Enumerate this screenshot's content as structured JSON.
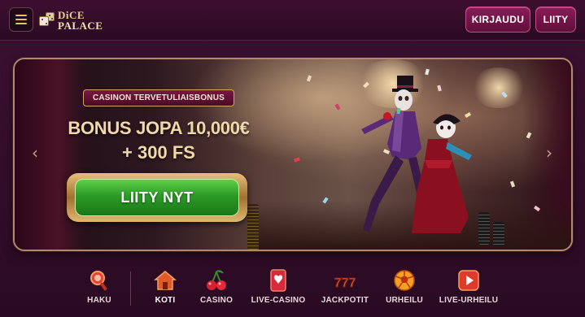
{
  "header": {
    "logo_line1": "DiCE",
    "logo_line2": "PALACE",
    "login_label": "KIRJAUDU",
    "join_label": "LIITY"
  },
  "banner": {
    "tag": "CASINON TERVETULIAISBONUS",
    "headline_line1": "BONUS JOPA 10,000€",
    "headline_line2": "+ 300 FS",
    "cta_label": "LIITY NYT",
    "prev_arrow": "‹",
    "next_arrow": "›"
  },
  "bottom_nav": {
    "items": [
      {
        "label": "HAKU",
        "icon": "search-icon"
      },
      {
        "label": "KOTI",
        "icon": "home-icon",
        "active": true
      },
      {
        "label": "CASINO",
        "icon": "cherries-icon"
      },
      {
        "label": "LIVE-CASINO",
        "icon": "playing-card-icon"
      },
      {
        "label": "JACKPOTIT",
        "icon": "slot-777-icon"
      },
      {
        "label": "URHEILU",
        "icon": "football-icon"
      },
      {
        "label": "LIVE-URHEILU",
        "icon": "play-icon"
      }
    ]
  },
  "colors": {
    "background": "#2a0a22",
    "header_button": "#8a1c58",
    "cta_green": "#2c9a26",
    "gold": "#f0d8a8"
  }
}
